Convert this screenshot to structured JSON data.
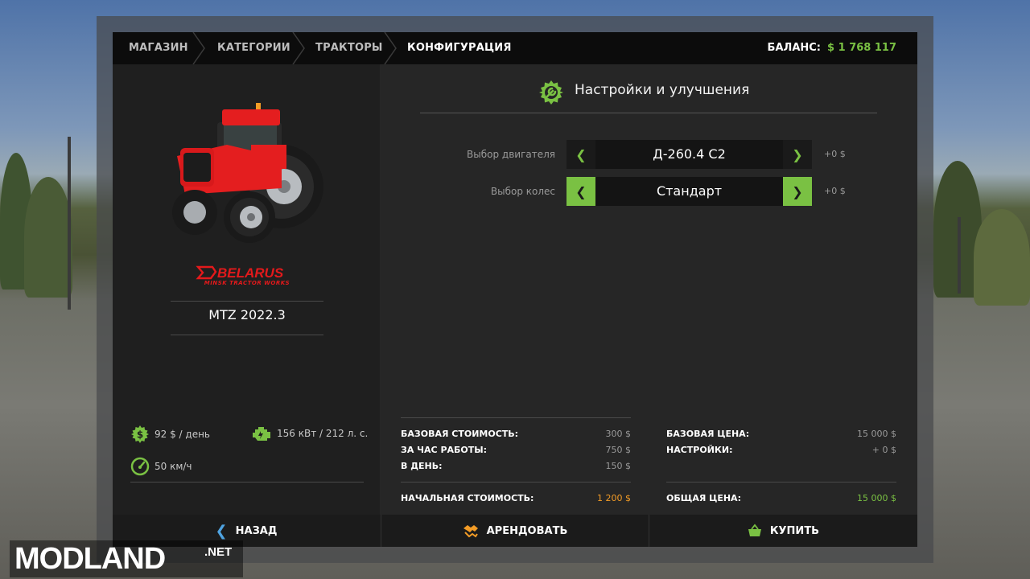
{
  "breadcrumb": [
    {
      "label": "МАГАЗИН"
    },
    {
      "label": "КАТЕГОРИИ"
    },
    {
      "label": "ТРАКТОРЫ"
    },
    {
      "label": "КОНФИГУРАЦИЯ"
    }
  ],
  "balance": {
    "label": "БАЛАНС:",
    "value": "$ 1 768 117"
  },
  "vehicle": {
    "brand_logo_text": "BELARUS",
    "brand_logo_sub": "MINSK TRACTOR WORKS",
    "name": "MTZ 2022.3",
    "stats": {
      "daily_cost": "92 $ / день",
      "power": "156 кВт / 212 л. с.",
      "speed": "50 км/ч"
    }
  },
  "config": {
    "title": "Настройки и улучшения",
    "options": [
      {
        "label": "Выбор двигателя",
        "value": "Д-260.4 С2",
        "price": "+0 $"
      },
      {
        "label": "Выбор колес",
        "value": "Стандарт",
        "price": "+0 $"
      }
    ]
  },
  "lease_costs": {
    "base_label": "БАЗОВАЯ СТОИМОСТЬ:",
    "base_value": "300 $",
    "hour_label": "ЗА ЧАС РАБОТЫ:",
    "hour_value": "750 $",
    "day_label": "В ДЕНЬ:",
    "day_value": "150 $",
    "initial_label": "НАЧАЛЬНАЯ СТОИМОСТЬ:",
    "initial_value": "1 200 $"
  },
  "buy_costs": {
    "base_label": "БАЗОВАЯ ЦЕНА:",
    "base_value": "15 000 $",
    "settings_label": "НАСТРОЙКИ:",
    "settings_value": "+ 0 $",
    "total_label": "ОБЩАЯ ЦЕНА:",
    "total_value": "15 000 $"
  },
  "footer": {
    "back": "НАЗАД",
    "lease": "АРЕНДОВАТЬ",
    "buy": "КУПИТЬ"
  },
  "watermark": {
    "text": "MODLAND",
    "suffix": ".NET"
  },
  "colors": {
    "accent": "#7ac143",
    "orange": "#f39c26",
    "brand_red": "#e3191b"
  }
}
